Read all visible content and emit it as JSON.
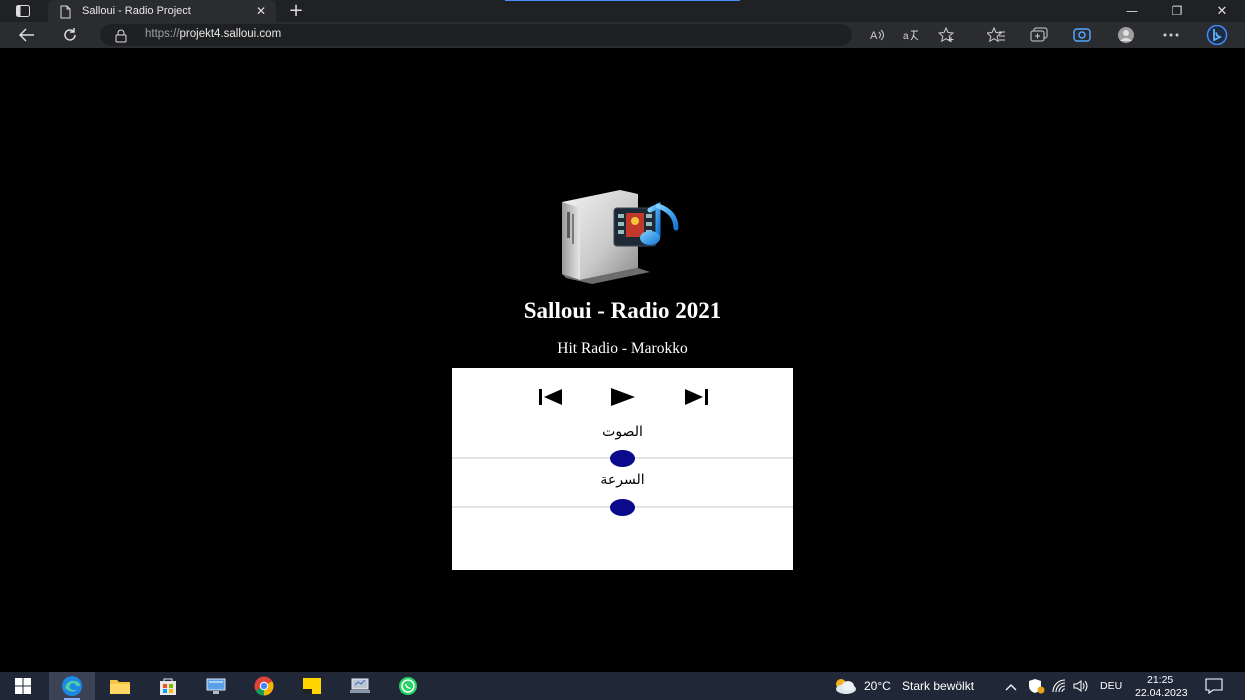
{
  "browser": {
    "tab_title": "Salloui - Radio Project",
    "close_tab": "✕",
    "new_tab": "+",
    "url_scheme": "https://",
    "url_host": "projekt4.salloui.com",
    "read_aloud": "A̵",
    "window_controls": {
      "minimize": "—",
      "maximize": "❐",
      "close": "✕"
    }
  },
  "page": {
    "title": "Salloui - Radio 2021",
    "subtitle": "Hit Radio - Marokko",
    "player": {
      "volume_label": "الصوت",
      "volume_level": 0.5,
      "speed_label": "السرعة",
      "speed_level": 0.5
    }
  },
  "taskbar": {
    "weather_temp": "20°C",
    "weather_text": "Stark bewölkt",
    "language": "DEU",
    "time": "21:25",
    "date": "22.04.2023"
  },
  "colors": {
    "page_background": "#000000",
    "player_background": "#ffffff",
    "slider_thumb": "#0c0a8c"
  }
}
